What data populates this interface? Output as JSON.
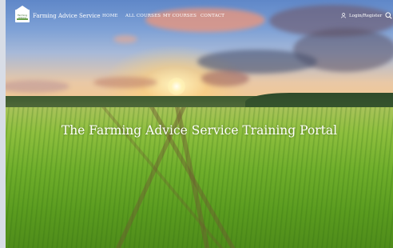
{
  "logo": {
    "text": "Farming Advice"
  },
  "site": {
    "name": "Farming Advice Service"
  },
  "menu": {
    "items": [
      {
        "label": "HOME"
      },
      {
        "label": "ALL COURSES"
      },
      {
        "label": "MY COURSES"
      },
      {
        "label": "CONTACT"
      }
    ]
  },
  "account": {
    "login_label": "Login/Register"
  },
  "icons": {
    "user": "user-icon",
    "search": "search-icon"
  },
  "hero": {
    "title": "The Farming Advice Service Training Portal",
    "image": "wheat-field-sunset"
  },
  "colors": {
    "nav_text": "#ffffff",
    "hero_text": "#ffffff",
    "field_green": "#6fae2b",
    "sky_blue": "#6f95cf"
  }
}
